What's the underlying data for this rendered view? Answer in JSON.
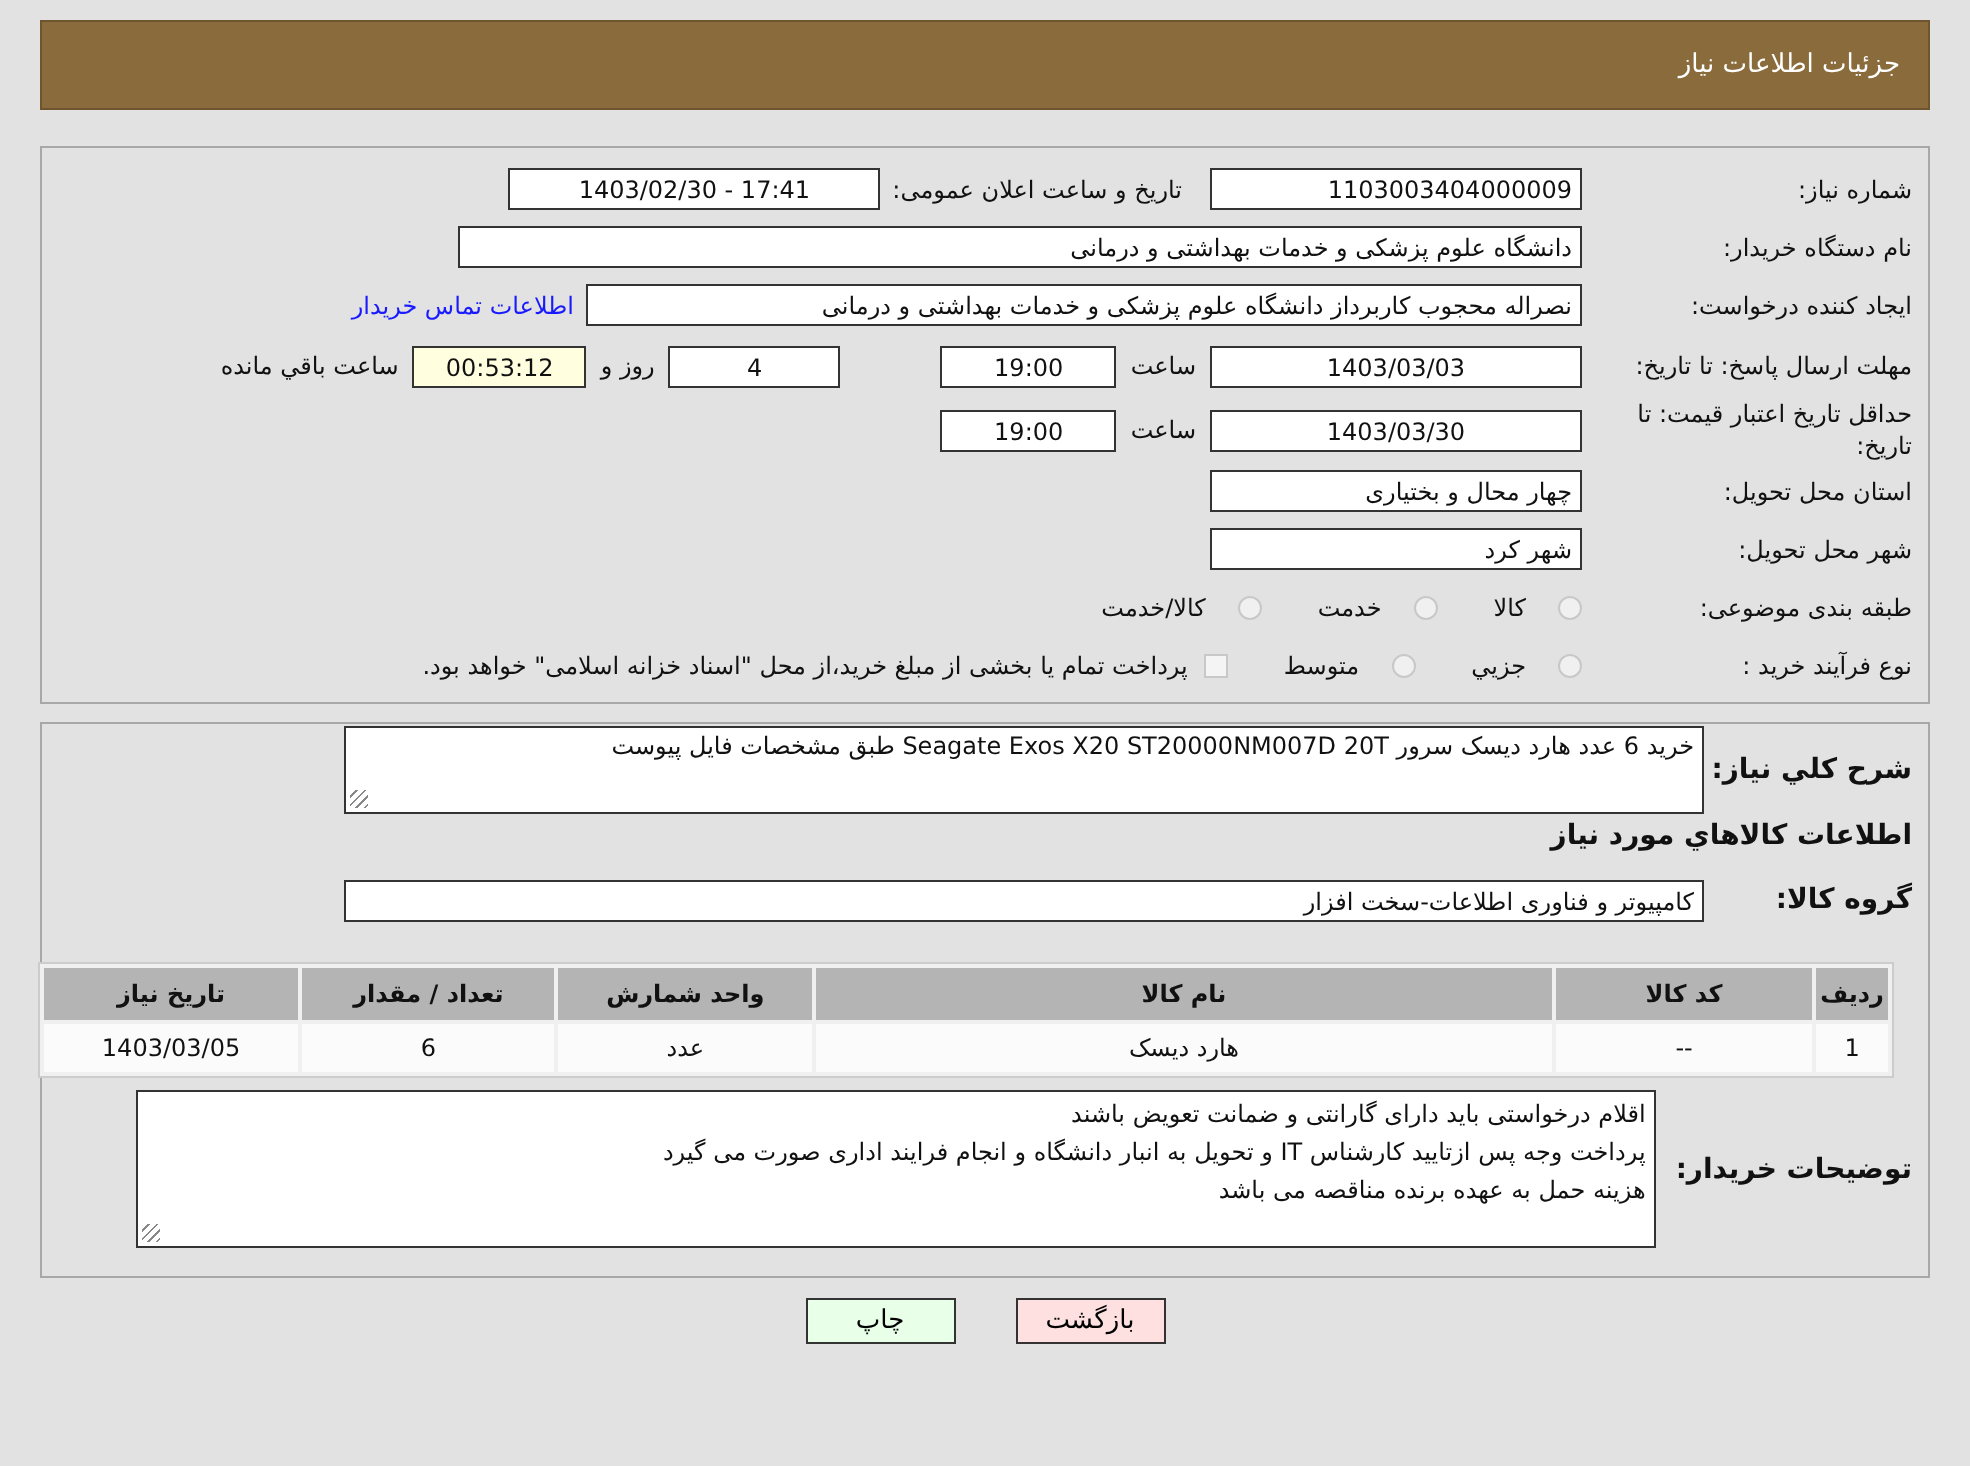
{
  "header": {
    "title": "جزئیات اطلاعات نیاز"
  },
  "details": {
    "need_number": {
      "label": "شماره نیاز:",
      "value": "1103003404000009"
    },
    "announce": {
      "label": "تاریخ و ساعت اعلان عمومی:",
      "value": "1403/02/30 - 17:41"
    },
    "buyer_org": {
      "label": "نام دستگاه خریدار:",
      "value": "دانشگاه علوم پزشکی و خدمات بهداشتی و درمانی"
    },
    "requester": {
      "label": "ایجاد کننده درخواست:",
      "value": "نصراله محجوب کاربرداز دانشگاه علوم پزشکی و خدمات بهداشتی و درمانی",
      "link": "اطلاعات تماس خریدار"
    },
    "response_deadline": {
      "label": "مهلت ارسال پاسخ: تا تاریخ:",
      "date": "1403/03/03",
      "time_label": "ساعت",
      "time": "19:00",
      "days": "4",
      "days_label": "روز و",
      "remaining": "00:53:12",
      "remaining_label": "ساعت باقي مانده"
    },
    "price_validity": {
      "label": "حداقل تاریخ اعتبار قیمت: تا تاریخ:",
      "date": "1403/03/30",
      "time_label": "ساعت",
      "time": "19:00"
    },
    "province": {
      "label": "استان محل تحویل:",
      "value": "چهار محال و بختیاری"
    },
    "city": {
      "label": "شهر محل تحویل:",
      "value": "شهر کرد"
    },
    "category": {
      "label": "طبقه بندی موضوعی:",
      "options": [
        {
          "label": "کالا",
          "selected": false
        },
        {
          "label": "خدمت",
          "selected": false
        },
        {
          "label": "کالا/خدمت",
          "selected": false
        }
      ]
    },
    "process": {
      "label": "نوع فرآیند خرید :",
      "options": [
        {
          "label": "جزيي",
          "selected": false
        },
        {
          "label": "متوسط",
          "selected": false
        }
      ],
      "payment_note": {
        "text": "پرداخت تمام یا بخشی از مبلغ خرید،از محل \"اسناد خزانه اسلامی\" خواهد بود.",
        "checked": false
      }
    }
  },
  "goods": {
    "description": {
      "label": "شرح کلي نیاز:",
      "value": "خرید 6 عدد هارد دیسک سرور  Seagate Exos X20 ST20000NM007D 20T طبق مشخصات فایل پیوست"
    },
    "section_title": "اطلاعات کالاهاي مورد نیاز",
    "group": {
      "label": "گروه کالا:",
      "value": "کامپیوتر و فناوری اطلاعات-سخت افزار"
    },
    "table": {
      "columns": [
        "ردیف",
        "کد کالا",
        "نام کالا",
        "واحد شمارش",
        "تعداد / مقدار",
        "تاریخ نیاز"
      ],
      "rows": [
        [
          "1",
          "--",
          "هارد دیسک",
          "عدد",
          "6",
          "1403/03/05"
        ]
      ]
    },
    "buyer_notes": {
      "label": "توضیحات خریدار:",
      "lines": [
        "اقلام درخواستی باید دارای گارانتی و ضمانت تعویض باشند",
        "پرداخت وجه پس ازتایید کارشناس IT و تحویل به انبار دانشگاه و انجام فرایند اداری صورت می گیرد",
        "هزینه حمل به عهده برنده مناقصه می باشد"
      ]
    }
  },
  "buttons": [
    {
      "label": "بازگشت",
      "kind": "back"
    },
    {
      "label": "چاپ",
      "kind": "print"
    }
  ]
}
